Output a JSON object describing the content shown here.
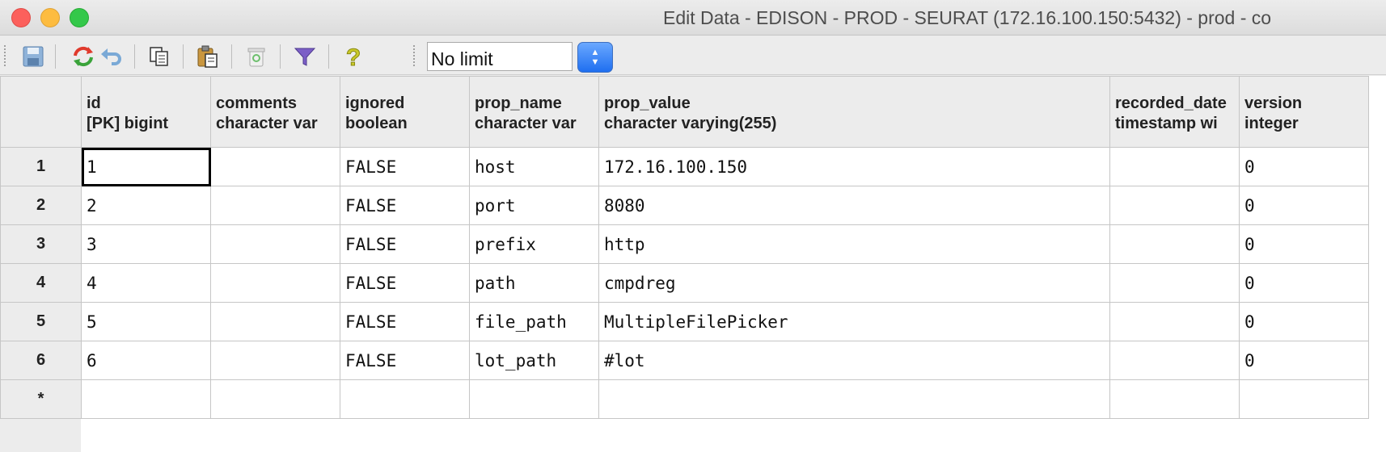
{
  "window": {
    "title": "Edit Data - EDISON - PROD - SEURAT (172.16.100.150:5432) - prod - co"
  },
  "toolbar": {
    "buttons": [
      {
        "name": "save-icon"
      },
      {
        "name": "refresh-icon"
      },
      {
        "name": "undo-icon"
      },
      {
        "name": "copy-icon"
      },
      {
        "name": "paste-icon"
      },
      {
        "name": "delete-icon"
      },
      {
        "name": "filter-icon"
      },
      {
        "name": "help-icon"
      }
    ],
    "limit": {
      "selected": "No limit"
    }
  },
  "grid": {
    "columns": [
      {
        "name": "id",
        "type": "[PK] bigint"
      },
      {
        "name": "comments",
        "type": "character var"
      },
      {
        "name": "ignored",
        "type": "boolean"
      },
      {
        "name": "prop_name",
        "type": "character var"
      },
      {
        "name": "prop_value",
        "type": "character varying(255)"
      },
      {
        "name": "recorded_date",
        "type": "timestamp wi"
      },
      {
        "name": "version",
        "type": "integer"
      }
    ],
    "rows": [
      {
        "num": "1",
        "id": "1",
        "comments": "",
        "ignored": "FALSE",
        "prop_name": "host",
        "prop_value": "172.16.100.150",
        "recorded_date": "",
        "version": "0"
      },
      {
        "num": "2",
        "id": "2",
        "comments": "",
        "ignored": "FALSE",
        "prop_name": "port",
        "prop_value": "8080",
        "recorded_date": "",
        "version": "0"
      },
      {
        "num": "3",
        "id": "3",
        "comments": "",
        "ignored": "FALSE",
        "prop_name": "prefix",
        "prop_value": "http",
        "recorded_date": "",
        "version": "0"
      },
      {
        "num": "4",
        "id": "4",
        "comments": "",
        "ignored": "FALSE",
        "prop_name": "path",
        "prop_value": "cmpdreg",
        "recorded_date": "",
        "version": "0"
      },
      {
        "num": "5",
        "id": "5",
        "comments": "",
        "ignored": "FALSE",
        "prop_name": "file_path",
        "prop_value": "MultipleFilePicker",
        "recorded_date": "",
        "version": "0"
      },
      {
        "num": "6",
        "id": "6",
        "comments": "",
        "ignored": "FALSE",
        "prop_name": "lot_path",
        "prop_value": "#lot",
        "recorded_date": "",
        "version": "0"
      }
    ],
    "new_row_marker": "*"
  }
}
